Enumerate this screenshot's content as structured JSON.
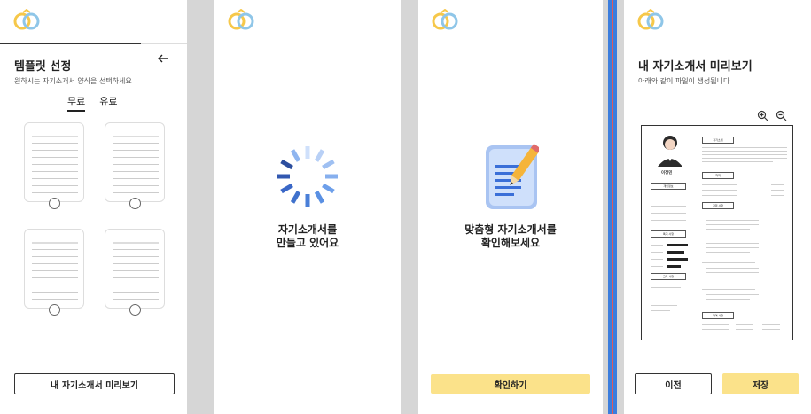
{
  "screen1": {
    "title": "템플릿 선정",
    "subtitle": "원하시는 자기소개서 양식을 선택하세요",
    "tabs": [
      "무료",
      "유료"
    ],
    "preview_button": "내 자기소개서 미리보기"
  },
  "screen2": {
    "message_line1": "자기소개서를",
    "message_line2": "만들고 있어요"
  },
  "screen3": {
    "message_line1": "맞춤형 자기소개서를",
    "message_line2": "확인해보세요",
    "confirm_button": "확인하기"
  },
  "screen4": {
    "title": "내 자기소개서 미리보기",
    "subtitle": "아래와 같이 파일이 생성됩니다",
    "prev_button": "이전",
    "save_button": "저장",
    "resume": {
      "name": "이정민",
      "section_intro": "자기소개",
      "section_education": "학력",
      "section_career": "경력 사항",
      "section_personal": "개인정보",
      "section_skills": "특기 사항",
      "section_edu_history": "교육 사항",
      "section_awards": "자격 사항"
    }
  },
  "colors": {
    "accent_yellow": "#fbe28a",
    "divider_blue": "#3b7ddd",
    "divider_red": "#e05a5a",
    "spinner_blue": "#3a67c7"
  }
}
